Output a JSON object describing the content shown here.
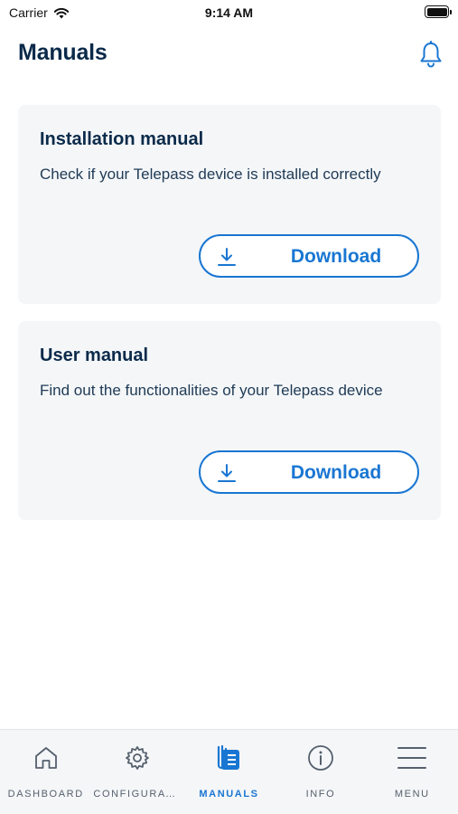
{
  "status_bar": {
    "carrier": "Carrier",
    "time": "9:14 AM"
  },
  "header": {
    "title": "Manuals",
    "bell_icon": "bell-icon"
  },
  "cards": [
    {
      "title": "Installation manual",
      "description": "Check if your Telepass device is installed correctly",
      "button_label": "Download",
      "button_icon": "download-icon"
    },
    {
      "title": "User manual",
      "description": "Find out the functionalities of your Telepass device",
      "button_label": "Download",
      "button_icon": "download-icon"
    }
  ],
  "tab_bar": {
    "active_index": 2,
    "tabs": [
      {
        "label": "DASHBOARD",
        "icon": "home-icon"
      },
      {
        "label": "CONFIGURATI…",
        "icon": "gear-icon"
      },
      {
        "label": "MANUALS",
        "icon": "manuals-icon"
      },
      {
        "label": "INFO",
        "icon": "info-icon"
      },
      {
        "label": "MENU",
        "icon": "menu-icon"
      }
    ]
  },
  "colors": {
    "accent": "#1976d2",
    "title": "#0b2a4a",
    "card_background": "#f4f6f8",
    "tab_inactive": "#55606d"
  }
}
